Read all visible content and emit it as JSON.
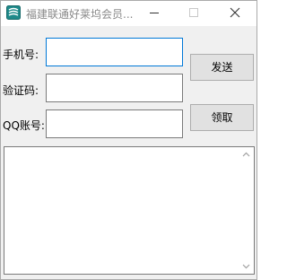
{
  "window": {
    "title": "福建联通好莱坞会员...",
    "app_icon": "app-logo-icon",
    "minimize_icon": "minimize-icon",
    "maximize_icon": "maximize-icon",
    "close_icon": "close-icon"
  },
  "form": {
    "phone_label": "手机号:",
    "phone_value": "",
    "code_label": "验证码:",
    "code_value": "",
    "qq_label": "QQ账号:",
    "qq_value": ""
  },
  "buttons": {
    "send_label": "发送",
    "claim_label": "领取"
  },
  "output": {
    "value": "",
    "scroll_up_icon": "chevron-up-icon",
    "scroll_down_icon": "chevron-down-icon"
  },
  "colors": {
    "focus_border": "#0078d7",
    "window_bg": "#f0f0f0",
    "button_bg": "#e1e1e1"
  }
}
